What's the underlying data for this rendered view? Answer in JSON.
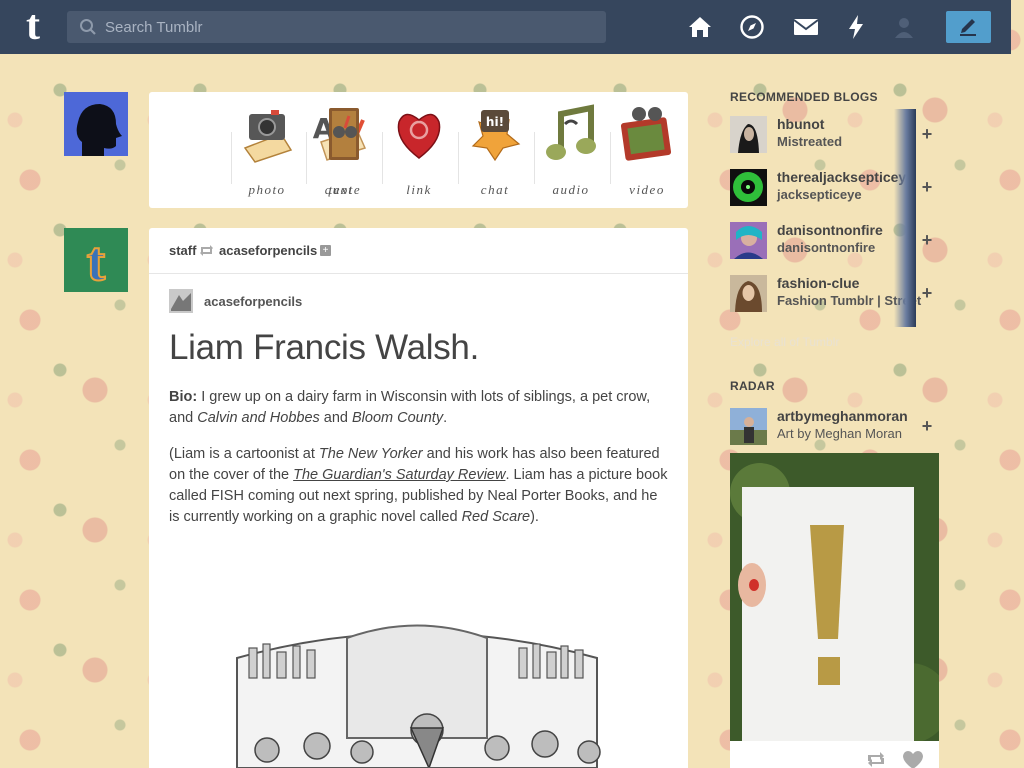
{
  "header": {
    "logo": "t",
    "search_placeholder": "Search Tumblr",
    "icons": [
      "home-icon",
      "explore-icon",
      "inbox-icon",
      "activity-icon",
      "account-icon",
      "compose-icon"
    ]
  },
  "colors": {
    "topbar": "#36465d",
    "accent": "#529ecc",
    "background": "#f3e3b8"
  },
  "post_types": [
    {
      "label": "text",
      "icon": "text-icon"
    },
    {
      "label": "photo",
      "icon": "camera-icon"
    },
    {
      "label": "quote",
      "icon": "quote-book-icon"
    },
    {
      "label": "link",
      "icon": "link-heart-icon"
    },
    {
      "label": "chat",
      "icon": "chat-bubble-icon"
    },
    {
      "label": "audio",
      "icon": "audio-note-icon"
    },
    {
      "label": "video",
      "icon": "video-film-icon"
    }
  ],
  "post": {
    "reblogger": "staff",
    "source": "acaseforpencils",
    "author": "acaseforpencils",
    "title": "Liam Francis Walsh.",
    "bio_label": "Bio:",
    "bio_text_1": " I grew up on a dairy farm in Wisconsin with lots of siblings, a pet crow, and ",
    "bio_italic_1": "Calvin and Hobbes",
    "bio_text_2": " and ",
    "bio_italic_2": "Bloom County",
    "bio_text_3": ".",
    "p2_text_1": "(Liam is a cartoonist at ",
    "p2_italic_1": "The New Yorker",
    "p2_text_2": " and his work has also been featured on the cover of the ",
    "p2_link": "The Guardian's Saturday Review",
    "p2_text_3": ". Liam has a picture book called FISH coming out next spring, published by Neal Porter Books, and he is currently working on a graphic novel called ",
    "p2_italic_2": "Red Scare",
    "p2_text_4": ")."
  },
  "sidebar": {
    "recommended_title": "RECOMMENDED BLOGS",
    "recommended": [
      {
        "name": "hbunot",
        "subtitle": "Mistreated",
        "add": "+"
      },
      {
        "name": "therealjacksepticeye",
        "subtitle": "jacksepticeye",
        "add": "+"
      },
      {
        "name": "danisontnonfire",
        "subtitle": "danisontnonfire",
        "add": "+"
      },
      {
        "name": "fashion-clue",
        "subtitle": "Fashion Tumblr | Street",
        "add": "+"
      }
    ],
    "explore_link": "Explore all of Tumblr",
    "radar_title": "RADAR",
    "radar": {
      "name": "artbymeghanmoran",
      "subtitle": "Art by Meghan Moran",
      "add": "+"
    }
  }
}
